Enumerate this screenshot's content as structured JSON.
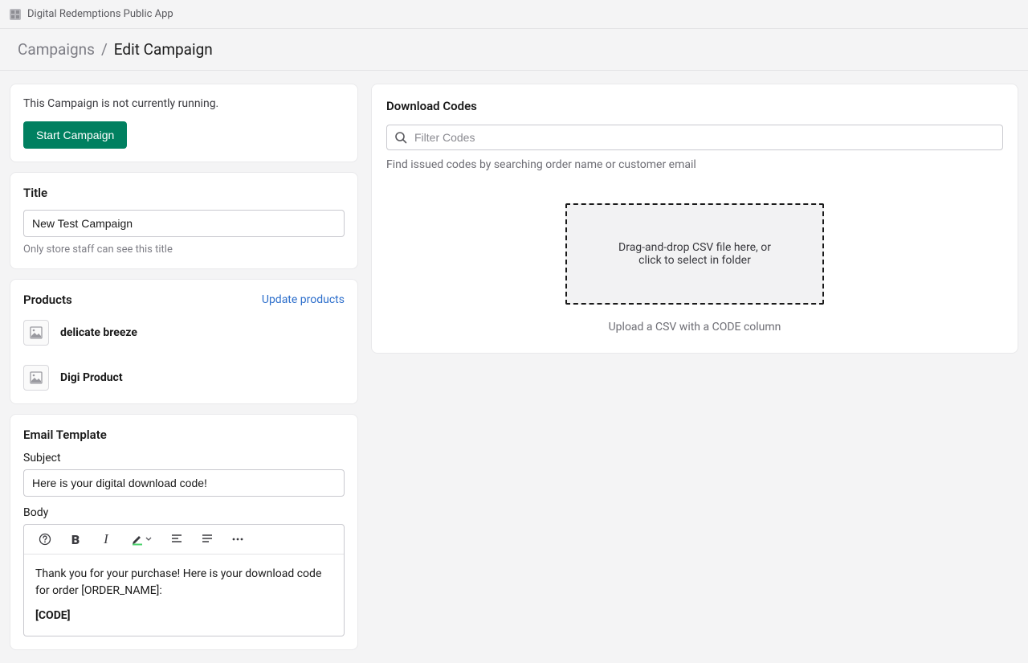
{
  "topbar": {
    "app_name": "Digital Redemptions Public App"
  },
  "breadcrumb": {
    "parent": "Campaigns",
    "sep": "/",
    "current": "Edit Campaign"
  },
  "status_card": {
    "message": "This Campaign is not currently running.",
    "start_label": "Start Campaign"
  },
  "title_card": {
    "heading": "Title",
    "value": "New Test Campaign",
    "helper": "Only store staff can see this title"
  },
  "products_card": {
    "heading": "Products",
    "update_label": "Update products",
    "items": [
      {
        "name": "delicate breeze"
      },
      {
        "name": "Digi Product"
      }
    ]
  },
  "email_card": {
    "heading": "Email Template",
    "subject_label": "Subject",
    "subject_value": "Here is your digital download code!",
    "body_label": "Body",
    "body_line1": "Thank you for your purchase! Here is your download code for order [ORDER_NAME]:",
    "body_line2": "[CODE]"
  },
  "codes_card": {
    "heading": "Download Codes",
    "search_placeholder": "Filter Codes",
    "search_help": "Find issued codes by searching order name or customer email",
    "dropzone_text": "Drag-and-drop CSV file here, or click to select in folder",
    "upload_help": "Upload a CSV with a CODE column"
  }
}
